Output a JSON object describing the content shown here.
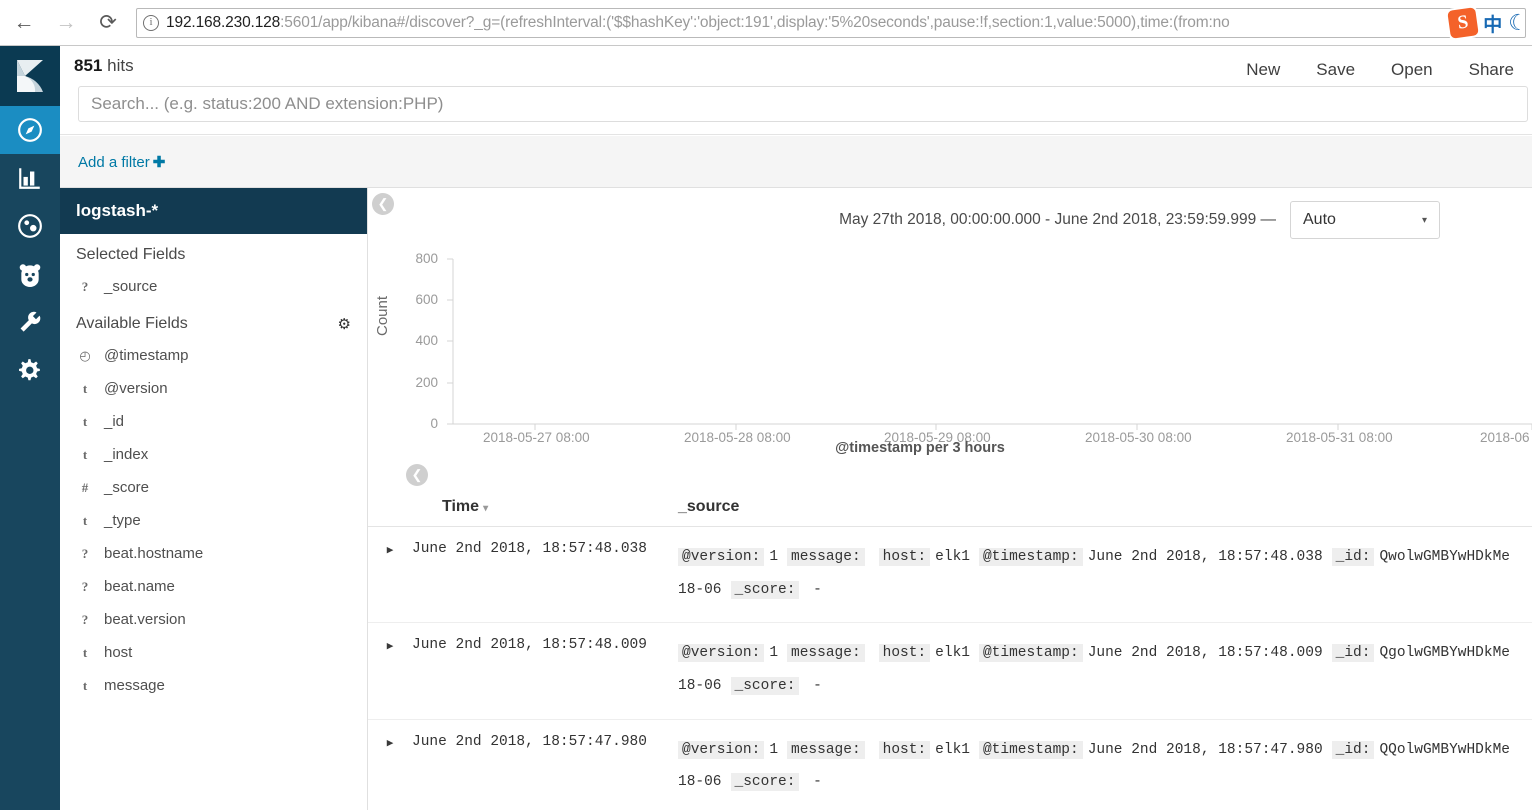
{
  "browser": {
    "back_icon": "arrow-left-icon",
    "forward_icon": "arrow-right-icon",
    "reload_icon": "reload-icon",
    "info_icon": "info-circle-icon",
    "url_host": "192.168.230.128",
    "url_rest": ":5601/app/kibana#/discover?_g=(refreshInterval:('$$hashKey':'object:191',display:'5%20seconds',pause:!f,section:1,value:5000),time:(from:no",
    "tray": {
      "sogou_label": "S",
      "ime_mode": "中",
      "moon_icon": "moon-icon"
    }
  },
  "global_nav": {
    "logo_name": "kibana-logo",
    "items": [
      {
        "name": "discover",
        "icon": "compass-icon",
        "active": true
      },
      {
        "name": "visualize",
        "icon": "bar-chart-icon",
        "active": false
      },
      {
        "name": "dashboard",
        "icon": "dashboard-globe-icon",
        "active": false
      },
      {
        "name": "timelion",
        "icon": "timelion-bear-icon",
        "active": false
      },
      {
        "name": "dev-tools",
        "icon": "wrench-icon",
        "active": false
      },
      {
        "name": "management",
        "icon": "gear-icon",
        "active": false
      }
    ]
  },
  "header": {
    "hits_count": "851",
    "hits_label": "hits",
    "search_placeholder": "Search... (e.g. status:200 AND extension:PHP)",
    "search_value": "",
    "menu": [
      "New",
      "Save",
      "Open",
      "Share"
    ]
  },
  "filter_bar": {
    "add_filter_label": "Add a filter",
    "plus": "✚"
  },
  "sidebar": {
    "index_pattern": "logstash-*",
    "selected_fields_label": "Selected Fields",
    "available_fields_label": "Available Fields",
    "settings_icon": "gear-icon",
    "selected_fields": [
      {
        "type": "?",
        "name": "_source"
      }
    ],
    "available_fields": [
      {
        "type": "◴",
        "name": "@timestamp"
      },
      {
        "type": "t",
        "name": "@version"
      },
      {
        "type": "t",
        "name": "_id"
      },
      {
        "type": "t",
        "name": "_index"
      },
      {
        "type": "#",
        "name": "_score"
      },
      {
        "type": "t",
        "name": "_type"
      },
      {
        "type": "?",
        "name": "beat.hostname"
      },
      {
        "type": "?",
        "name": "beat.name"
      },
      {
        "type": "?",
        "name": "beat.version"
      },
      {
        "type": "t",
        "name": "host"
      },
      {
        "type": "t",
        "name": "message"
      }
    ]
  },
  "main": {
    "collapse_icon": "chevron-left-circle-icon",
    "time_range": "May 27th 2018, 00:00:00.000 - June 2nd 2018, 23:59:59.999 —",
    "interval_value": "Auto",
    "interval_caret": "▾",
    "sort_toggle_icon": "chevron-up-circle-icon",
    "table_headers": {
      "time": "Time",
      "source": "_source"
    },
    "time_sort_caret": "▾"
  },
  "chart_data": {
    "type": "bar",
    "title": "",
    "xlabel": "@timestamp per 3 hours",
    "ylabel": "Count",
    "ylim": [
      0,
      800
    ],
    "yticks": [
      0,
      200,
      400,
      600,
      800
    ],
    "xticks": [
      "2018-05-27 08:00",
      "2018-05-28 08:00",
      "2018-05-29 08:00",
      "2018-05-30 08:00",
      "2018-05-31 08:00",
      "2018-06"
    ],
    "categories": [],
    "values": [],
    "grid": false,
    "legend": "none"
  },
  "documents": [
    {
      "time": "June 2nd 2018, 18:57:48.038",
      "expand_icon": "triangle-right-icon",
      "fields": [
        {
          "key": "@version:",
          "value": "1"
        },
        {
          "key": "message:",
          "value": ""
        },
        {
          "key": "host:",
          "value": "elk1"
        },
        {
          "key": "@timestamp:",
          "value": "June 2nd 2018, 18:57:48.038"
        },
        {
          "key": "_id:",
          "value": "QwolwGMBYwHDkMe"
        }
      ],
      "wrap_text": "18-06",
      "score_key": "_score:",
      "score_value": "-"
    },
    {
      "time": "June 2nd 2018, 18:57:48.009",
      "expand_icon": "triangle-right-icon",
      "fields": [
        {
          "key": "@version:",
          "value": "1"
        },
        {
          "key": "message:",
          "value": ""
        },
        {
          "key": "host:",
          "value": "elk1"
        },
        {
          "key": "@timestamp:",
          "value": "June 2nd 2018, 18:57:48.009"
        },
        {
          "key": "_id:",
          "value": "QgolwGMBYwHDkMe"
        }
      ],
      "wrap_text": "18-06",
      "score_key": "_score:",
      "score_value": "-"
    },
    {
      "time": "June 2nd 2018, 18:57:47.980",
      "expand_icon": "triangle-right-icon",
      "fields": [
        {
          "key": "@version:",
          "value": "1"
        },
        {
          "key": "message:",
          "value": ""
        },
        {
          "key": "host:",
          "value": "elk1"
        },
        {
          "key": "@timestamp:",
          "value": "June 2nd 2018, 18:57:47.980"
        },
        {
          "key": "_id:",
          "value": "QQolwGMBYwHDkMe"
        }
      ],
      "wrap_text": "18-06",
      "score_key": "_score:",
      "score_value": "-"
    }
  ],
  "colors": {
    "kibana_nav": "#18465e",
    "kibana_nav_dark": "#0b3a52",
    "active_nav": "#1b8dc2",
    "link": "#0079a5",
    "index_header": "#123a51"
  }
}
